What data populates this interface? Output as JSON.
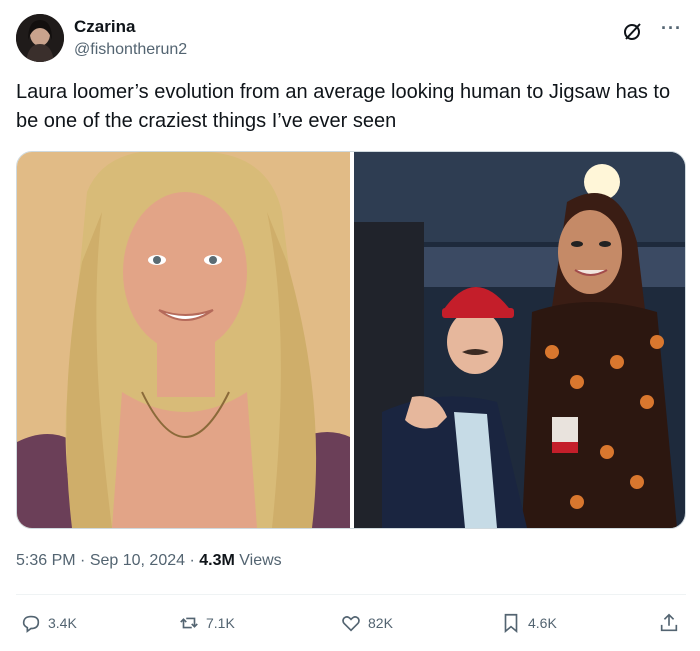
{
  "author": {
    "display_name": "Czarina",
    "handle": "@fishontherun2"
  },
  "header_icons": {
    "grok": "grok-icon",
    "more": "···"
  },
  "tweet": {
    "text": "Laura loomer’s evolution from an average looking human to Jigsaw has to be one of the craziest things I’ve ever seen"
  },
  "meta": {
    "time": "5:36 PM",
    "sep1": " · ",
    "date": "Sep 10, 2024",
    "sep2": " · ",
    "views": "4.3M",
    "views_label": " Views"
  },
  "actions": {
    "replies": "3.4K",
    "reposts": "7.1K",
    "likes": "82K",
    "bookmarks": "4.6K"
  },
  "colors": {
    "text": "#0f1419",
    "secondary": "#536471",
    "border": "#cfd9de",
    "hat_red": "#c41e2a"
  }
}
